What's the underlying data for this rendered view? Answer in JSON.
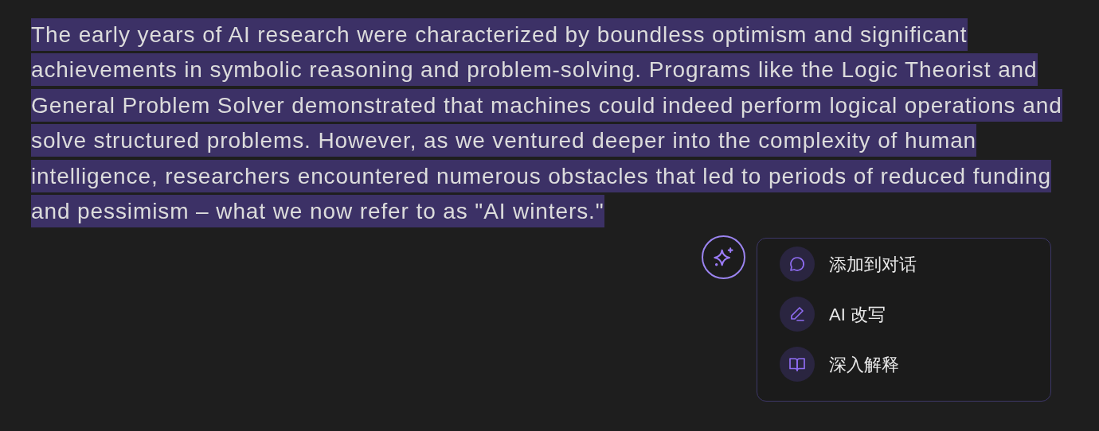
{
  "paragraph": {
    "text": "The early years of AI research were characterized by boundless optimism and significant achievements in symbolic reasoning and problem-solving. Programs like the Logic Theorist and General Problem Solver demonstrated that machines could indeed perform logical operations and solve structured problems. However, as we ventured deeper into the complexity of human intelligence, researchers encountered numerous obstacles that led to periods of reduced funding and pessimism – what we now refer to as \"AI winters.\"",
    "selected": true
  },
  "menu": {
    "items": [
      {
        "kind": "chat",
        "label": "添加到对话"
      },
      {
        "kind": "edit",
        "label": "AI 改写"
      },
      {
        "kind": "book",
        "label": "深入解释"
      }
    ]
  }
}
